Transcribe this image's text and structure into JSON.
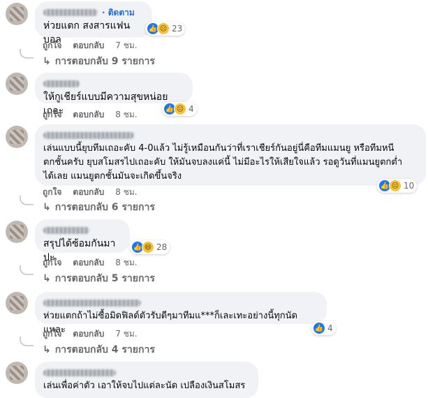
{
  "comments": [
    {
      "follow_label": "· ติดตาม",
      "text": "ห่วยแตก สงสารแฟนบอล",
      "reaction_count": "23",
      "like": "ถูกใจ",
      "reply": "ตอบกลับ",
      "time": "7 ชม.",
      "replies": "การตอบกลับ 9 รายการ"
    },
    {
      "text": "ให้กูเชียร์แบบมีความสุขหน่อยเถอะ",
      "reaction_count": "4",
      "like": "ถูกใจ",
      "reply": "ตอบกลับ",
      "time": "8 ชม."
    },
    {
      "text": "เล่นแบบนี้ยุบทีมเถอะคับ 4-0แล้ว ไม่รู้เหมือนกันว่าที่เราเชียร์กันอยู่นี่คือทีมแมนยู หรือทีมหนีตกชั้นครับ ยุบสโมสรไปเถอะคับ ให้มันจบลงแค่นี้ ไม่มีอะไรให้เสียใจแล้ว รอดูวันที่แมนยูตกต่ำได้เลย แมนยูตกชั้นมันจะเกิดขึ้นจริง",
      "line1": "เล่นแบบนี้ยุบทีมเถอะคับ 4-0แล้ว ไม่รู้เหมือนกันว่าที่เราเชียร์กันอยู่นี่คือทีมแมนยู หรือทีมหนี",
      "line2": "ตกชั้นครับ ยุบสโมสรไปเถอะคับ ให้มันจบลงแค่นี้ ไม่มีอะไรให้เสียใจแล้ว รอดูวันที่แมนยูตกต่ำ",
      "line3": "ได้เลย แมนยูตกชั้นมันจะเกิดขึ้นจริง",
      "reaction_count": "10",
      "like": "ถูกใจ",
      "reply": "ตอบกลับ",
      "time": "8 ชม.",
      "replies": "การตอบกลับ 6 รายการ"
    },
    {
      "text": "สรุปได้ซ้อมกันมาปะ",
      "reaction_count": "28",
      "like": "ถูกใจ",
      "reply": "ตอบกลับ",
      "time": "8 ชม.",
      "replies": "การตอบกลับ 5 รายการ"
    },
    {
      "text": "ห่วยแตกถ้าไม่ซื้อมิดฟิลด์ตัวรับดีๆมาทีมแ***ก็เละเทะอย่างนี้ทุกนัดแหละ",
      "reaction_count": "4",
      "like": "ถูกใจ",
      "reply": "ตอบกลับ",
      "time": "7 ชม.",
      "replies": "การตอบกลับ 4 รายการ"
    },
    {
      "text": "เล่นเพื่อค่าตัว เอาให้จบไปแต่ละนัด เปลืองเงินสโมสร"
    }
  ],
  "icons": {
    "like": "like-reaction-icon",
    "sad": "sad-reaction-icon",
    "haha": "haha-reaction-icon",
    "reply_arrow": "reply-arrow-icon"
  },
  "colors": {
    "link": "#216fdb",
    "bubble": "#f0f2f5",
    "muted": "#65676b"
  }
}
